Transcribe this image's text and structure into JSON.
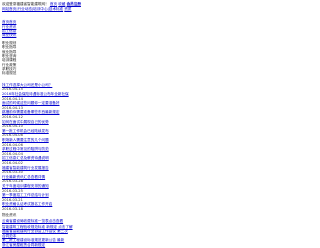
{
  "header": {
    "line1_text": "欢迎登录福建省智能建筑网！",
    "line1_links": [
      "首页",
      "收藏"
    ],
    "line1_tail": "会员注册",
    "line2_text": "网站首页|行业动态|培训中心|技术标准",
    "line2_links": [
      "资质"
    ]
  },
  "nav": {
    "items": [
      {
        "label": "首页首页"
      },
      {
        "label": "行业资讯"
      },
      {
        "label": "招工信息"
      },
      {
        "label": "商业快讯"
      },
      {
        "label": "职业规划"
      },
      {
        "label": "职业指导"
      },
      {
        "label": "就业指导"
      },
      {
        "label": "职业咨询"
      },
      {
        "label": "培训课程"
      },
      {
        "label": "行业政策"
      },
      {
        "label": "求职技巧"
      },
      {
        "label": "标准规范"
      }
    ]
  },
  "news": {
    "items": [
      {
        "title": "找工作选择大公司还是小公司？",
        "date": "2016-04-15",
        "highlight": false
      },
      {
        "title": "2016年社会保险待遇标准公布年全新社保",
        "date": "2016-04-14",
        "highlight": false
      },
      {
        "title": "面试的时候这些问题你一定要准备好",
        "date": "2016-04-13",
        "highlight": true
      },
      {
        "title": "跳槽前你需要准备哪些东西最新规定",
        "date": "2016-04-12",
        "highlight": false
      },
      {
        "title": "如何在面试中展现自己的优势",
        "date": "2016-04-10",
        "highlight": false
      },
      {
        "title": "第一批工作机会已经陆续发布",
        "date": "2016-04-08",
        "highlight": true
      },
      {
        "title": "职场新人需要注意的几个问题",
        "date": "2016-04-06",
        "highlight": false
      },
      {
        "title": "求职过程中常见的陷阱与防范",
        "date": "2016-04-04",
        "highlight": false
      },
      {
        "title": "招工信息汇总及薪资待遇说明",
        "date": "2016-04-02",
        "highlight": false
      },
      {
        "title": "福建省智能建筑行业发展报告",
        "date": "2016-03-30",
        "highlight": false
      },
      {
        "title": "行业最新资讯汇总查看详情",
        "date": "2016-03-28",
        "highlight": true
      },
      {
        "title": "关于年度培训课程安排的通知",
        "date": "2016-03-25",
        "highlight": false
      },
      {
        "title": "第一季度招工工作总结与计划",
        "date": "2016-03-21",
        "highlight": false
      },
      {
        "title": "职业资格认证考试报名工作开启",
        "date": "2016-03-18",
        "highlight": false
      }
    ]
  },
  "footer": {
    "label": "物业资讯",
    "lines": [
      "云南省建设局收费标准一览表点击查看",
      "智能建筑工程验收规范标准 新规定 点击了解",
      "福建省智能建筑行业协会工作会议 第三次",
      "合同范本",
      "第二批工程建设标准规范更新公告 最新",
      "浙江省房屋租赁合同新规定"
    ]
  },
  "colors": {
    "link": "#0000cc",
    "text": "#222222",
    "highlight": "#b22222"
  }
}
